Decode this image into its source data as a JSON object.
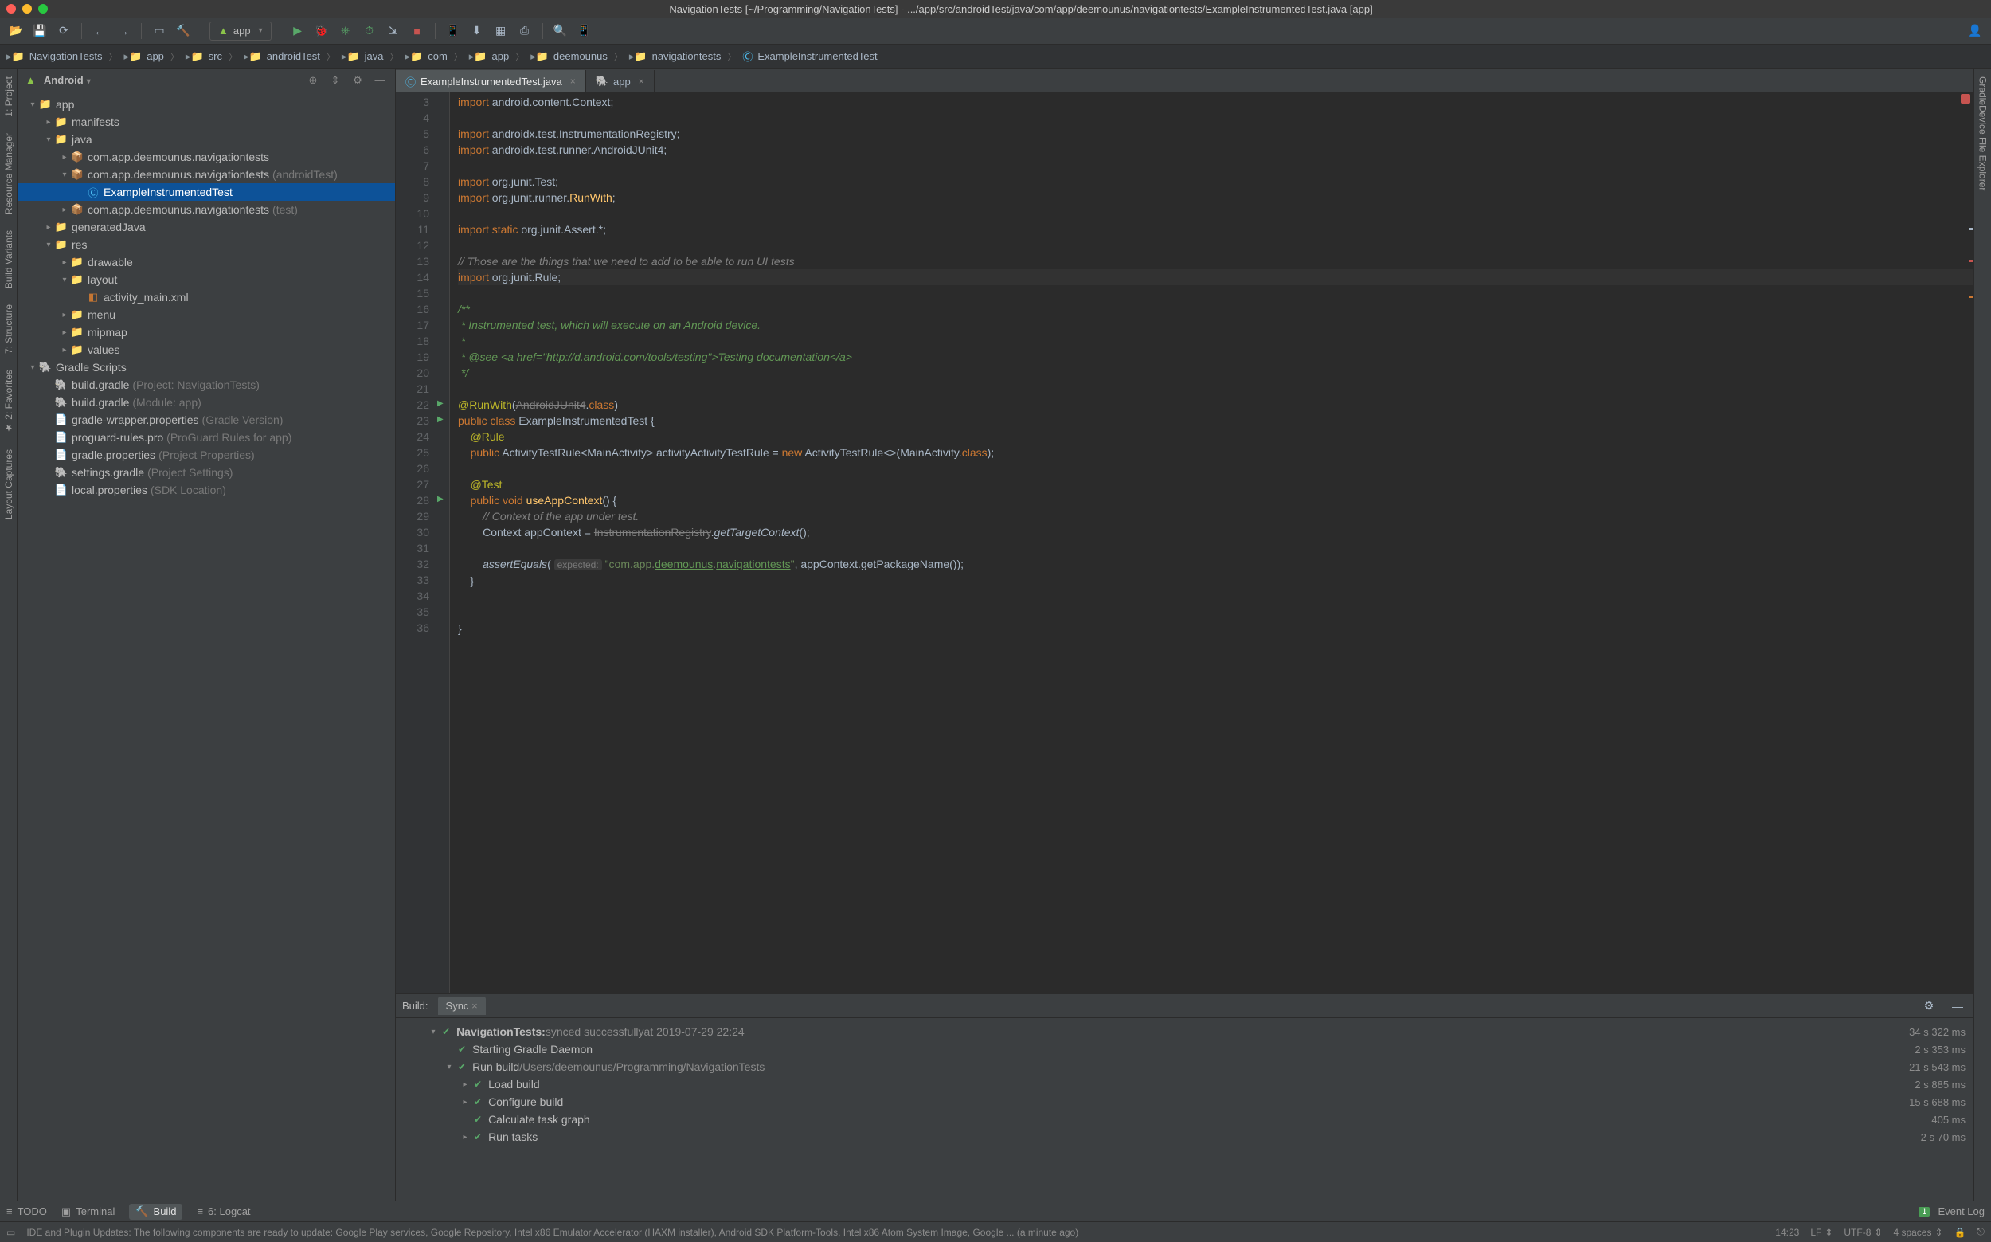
{
  "title": "NavigationTests [~/Programming/NavigationTests] - .../app/src/androidTest/java/com/app/deemounus/navigationtests/ExampleInstrumentedTest.java [app]",
  "toolbar": {
    "run_config": "app"
  },
  "breadcrumbs": [
    "NavigationTests",
    "app",
    "src",
    "androidTest",
    "java",
    "com",
    "app",
    "deemounus",
    "navigationtests",
    "ExampleInstrumentedTest"
  ],
  "tree_header": {
    "label": "Android"
  },
  "tree": [
    {
      "d": 0,
      "exp": "▾",
      "ic": "📁",
      "label": "app",
      "cls": "branch"
    },
    {
      "d": 1,
      "exp": "▸",
      "ic": "📁",
      "label": "manifests"
    },
    {
      "d": 1,
      "exp": "▾",
      "ic": "📁",
      "label": "java"
    },
    {
      "d": 2,
      "exp": "▸",
      "ic": "📦",
      "label": "com.app.deemounus.navigationtests"
    },
    {
      "d": 2,
      "exp": "▾",
      "ic": "📦",
      "label": "com.app.deemounus.navigationtests",
      "suffix": "(androidTest)"
    },
    {
      "d": 3,
      "exp": "",
      "ic": "Ⓒ",
      "label": "ExampleInstrumentedTest",
      "sel": true,
      "cls": "icon-cyan"
    },
    {
      "d": 2,
      "exp": "▸",
      "ic": "📦",
      "label": "com.app.deemounus.navigationtests",
      "suffix": "(test)"
    },
    {
      "d": 1,
      "exp": "▸",
      "ic": "📁",
      "label": "generatedJava"
    },
    {
      "d": 1,
      "exp": "▾",
      "ic": "📁",
      "label": "res"
    },
    {
      "d": 2,
      "exp": "▸",
      "ic": "📁",
      "label": "drawable"
    },
    {
      "d": 2,
      "exp": "▾",
      "ic": "📁",
      "label": "layout"
    },
    {
      "d": 3,
      "exp": "",
      "ic": "◧",
      "label": "activity_main.xml",
      "cls": "xml-icon"
    },
    {
      "d": 2,
      "exp": "▸",
      "ic": "📁",
      "label": "menu"
    },
    {
      "d": 2,
      "exp": "▸",
      "ic": "📁",
      "label": "mipmap"
    },
    {
      "d": 2,
      "exp": "▸",
      "ic": "📁",
      "label": "values"
    },
    {
      "d": 0,
      "exp": "▾",
      "ic": "🐘",
      "label": "Gradle Scripts",
      "cls": "branch"
    },
    {
      "d": 1,
      "exp": "",
      "ic": "🐘",
      "label": "build.gradle",
      "suffix": "(Project: NavigationTests)"
    },
    {
      "d": 1,
      "exp": "",
      "ic": "🐘",
      "label": "build.gradle",
      "suffix": "(Module: app)"
    },
    {
      "d": 1,
      "exp": "",
      "ic": "📄",
      "label": "gradle-wrapper.properties",
      "suffix": "(Gradle Version)"
    },
    {
      "d": 1,
      "exp": "",
      "ic": "📄",
      "label": "proguard-rules.pro",
      "suffix": "(ProGuard Rules for app)"
    },
    {
      "d": 1,
      "exp": "",
      "ic": "📄",
      "label": "gradle.properties",
      "suffix": "(Project Properties)"
    },
    {
      "d": 1,
      "exp": "",
      "ic": "🐘",
      "label": "settings.gradle",
      "suffix": "(Project Settings)"
    },
    {
      "d": 1,
      "exp": "",
      "ic": "📄",
      "label": "local.properties",
      "suffix": "(SDK Location)"
    }
  ],
  "editor_tabs": [
    {
      "label": "ExampleInstrumentedTest.java",
      "active": true,
      "ic": "Ⓒ"
    },
    {
      "label": "app",
      "active": false,
      "ic": "🐘"
    }
  ],
  "gutter_start": 3,
  "gutter_end": 36,
  "code_lines": [
    {
      "n": 3,
      "html": "<span class='kw'>import</span> android.content.Context;"
    },
    {
      "n": 4,
      "html": ""
    },
    {
      "n": 5,
      "html": "<span class='kw'>import</span> androidx.test.InstrumentationRegistry;"
    },
    {
      "n": 6,
      "html": "<span class='kw'>import</span> androidx.test.runner.AndroidJUnit4;"
    },
    {
      "n": 7,
      "html": ""
    },
    {
      "n": 8,
      "html": "<span class='kw'>import</span> org.junit.Test;"
    },
    {
      "n": 9,
      "html": "<span class='kw'>import</span> org.junit.runner.<span class='fn'>RunWith</span>;"
    },
    {
      "n": 10,
      "html": ""
    },
    {
      "n": 11,
      "html": "<span class='kw'>import static</span> org.junit.Assert.*;"
    },
    {
      "n": 12,
      "html": ""
    },
    {
      "n": 13,
      "html": "<span class='cm'>// Those are the things that we need to add to be able to run UI tests</span>"
    },
    {
      "n": 14,
      "html": "<span class='caret-line'><span class='kw'>import</span> org.junit.Rule;</span>",
      "caret": true
    },
    {
      "n": 15,
      "html": ""
    },
    {
      "n": 16,
      "html": "<span class='doc'>/**</span>"
    },
    {
      "n": 17,
      "html": "<span class='doc'> * Instrumented test, which will execute on an Android device.</span>"
    },
    {
      "n": 18,
      "html": "<span class='doc'> *</span>"
    },
    {
      "n": 19,
      "html": "<span class='doc'> * <span class='link'>@see</span> &lt;a href=\"http://d.android.com/tools/testing\"&gt;Testing documentation&lt;/a&gt;</span>"
    },
    {
      "n": 20,
      "html": "<span class='doc'> */</span>"
    },
    {
      "n": 21,
      "html": ""
    },
    {
      "n": 22,
      "html": "<span class='ann'>@RunWith</span>(<span class='strike'>AndroidJUnit4</span>.<span class='kw'>class</span>)",
      "ind": true
    },
    {
      "n": 23,
      "html": "<span class='kw'>public class</span> ExampleInstrumentedTest {",
      "ind": true
    },
    {
      "n": 24,
      "html": "    <span class='ann'>@Rule</span>"
    },
    {
      "n": 25,
      "html": "    <span class='kw'>public</span> <span class='cls'>ActivityTestRule</span>&lt;MainActivity&gt; activityActivityTestRule = <span class='kw'>new</span> <span class='cls'>ActivityTestRule</span>&lt;&gt;(MainActivity.<span class='kw'>class</span>);"
    },
    {
      "n": 26,
      "html": ""
    },
    {
      "n": 27,
      "html": "    <span class='ann'>@Test</span>"
    },
    {
      "n": 28,
      "html": "    <span class='kw'>public void</span> <span class='fn'>useAppContext</span>() {",
      "ind": true
    },
    {
      "n": 29,
      "html": "        <span class='cm'>// Context of the app under test.</span>"
    },
    {
      "n": 30,
      "html": "        Context appContext = <span class='strike'>InstrumentationRegistry</span>.<span style='font-style:italic'>getTargetContext</span>();"
    },
    {
      "n": 31,
      "html": ""
    },
    {
      "n": 32,
      "html": "        <span style='font-style:italic'>assertEquals</span>( <span class='hint'>expected:</span> <span class='str'>\"com.app.<span class='link'>deemounus</span>.<span class='link'>navigationtests</span>\"</span>, appContext.getPackageName());"
    },
    {
      "n": 33,
      "html": "    }"
    },
    {
      "n": 34,
      "html": ""
    },
    {
      "n": 35,
      "html": ""
    },
    {
      "n": 36,
      "html": "}"
    }
  ],
  "build": {
    "tab_label": "Build:",
    "tabs": [
      "Sync"
    ],
    "rows": [
      {
        "d": 0,
        "exp": "▾",
        "label": "NavigationTests:",
        "sub": " synced successfully",
        "after": " at 2019-07-29 22:24",
        "time": "34 s 322 ms",
        "bold": true
      },
      {
        "d": 1,
        "exp": "",
        "label": "Starting Gradle Daemon",
        "time": "2 s 353 ms"
      },
      {
        "d": 1,
        "exp": "▾",
        "label": "Run build",
        "sub": " /Users/deemounus/Programming/NavigationTests",
        "time": "21 s 543 ms"
      },
      {
        "d": 2,
        "exp": "▸",
        "label": "Load build",
        "time": "2 s 885 ms"
      },
      {
        "d": 2,
        "exp": "▸",
        "label": "Configure build",
        "time": "15 s 688 ms"
      },
      {
        "d": 2,
        "exp": "",
        "label": "Calculate task graph",
        "time": "405 ms"
      },
      {
        "d": 2,
        "exp": "▸",
        "label": "Run tasks",
        "time": "2 s 70 ms"
      }
    ]
  },
  "tooltabs": {
    "left": [
      {
        "ic": "≡",
        "label": "TODO"
      },
      {
        "ic": "▣",
        "label": "Terminal"
      },
      {
        "ic": "🔨",
        "label": "Build",
        "active": true
      },
      {
        "ic": "≡",
        "label": "6: Logcat"
      }
    ],
    "eventlog": {
      "badge": "1",
      "label": "Event Log"
    }
  },
  "sideL": [
    "1: Project",
    "Resource Manager"
  ],
  "sideL2": [
    "Build Variants",
    "7: Structure",
    "★ 2: Favorites",
    "Layout Captures"
  ],
  "sideR": [
    "Gradle"
  ],
  "sideR2": [
    "Device File Explorer"
  ],
  "status": {
    "msg": "IDE and Plugin Updates: The following components are ready to update: Google Play services, Google Repository, Intel x86 Emulator Accelerator (HAXM installer), Android SDK Platform-Tools, Intel x86 Atom System Image, Google ... (a minute ago)",
    "pos": "14:23",
    "eol": "LF",
    "enc": "UTF-8",
    "indent": "4 spaces"
  }
}
